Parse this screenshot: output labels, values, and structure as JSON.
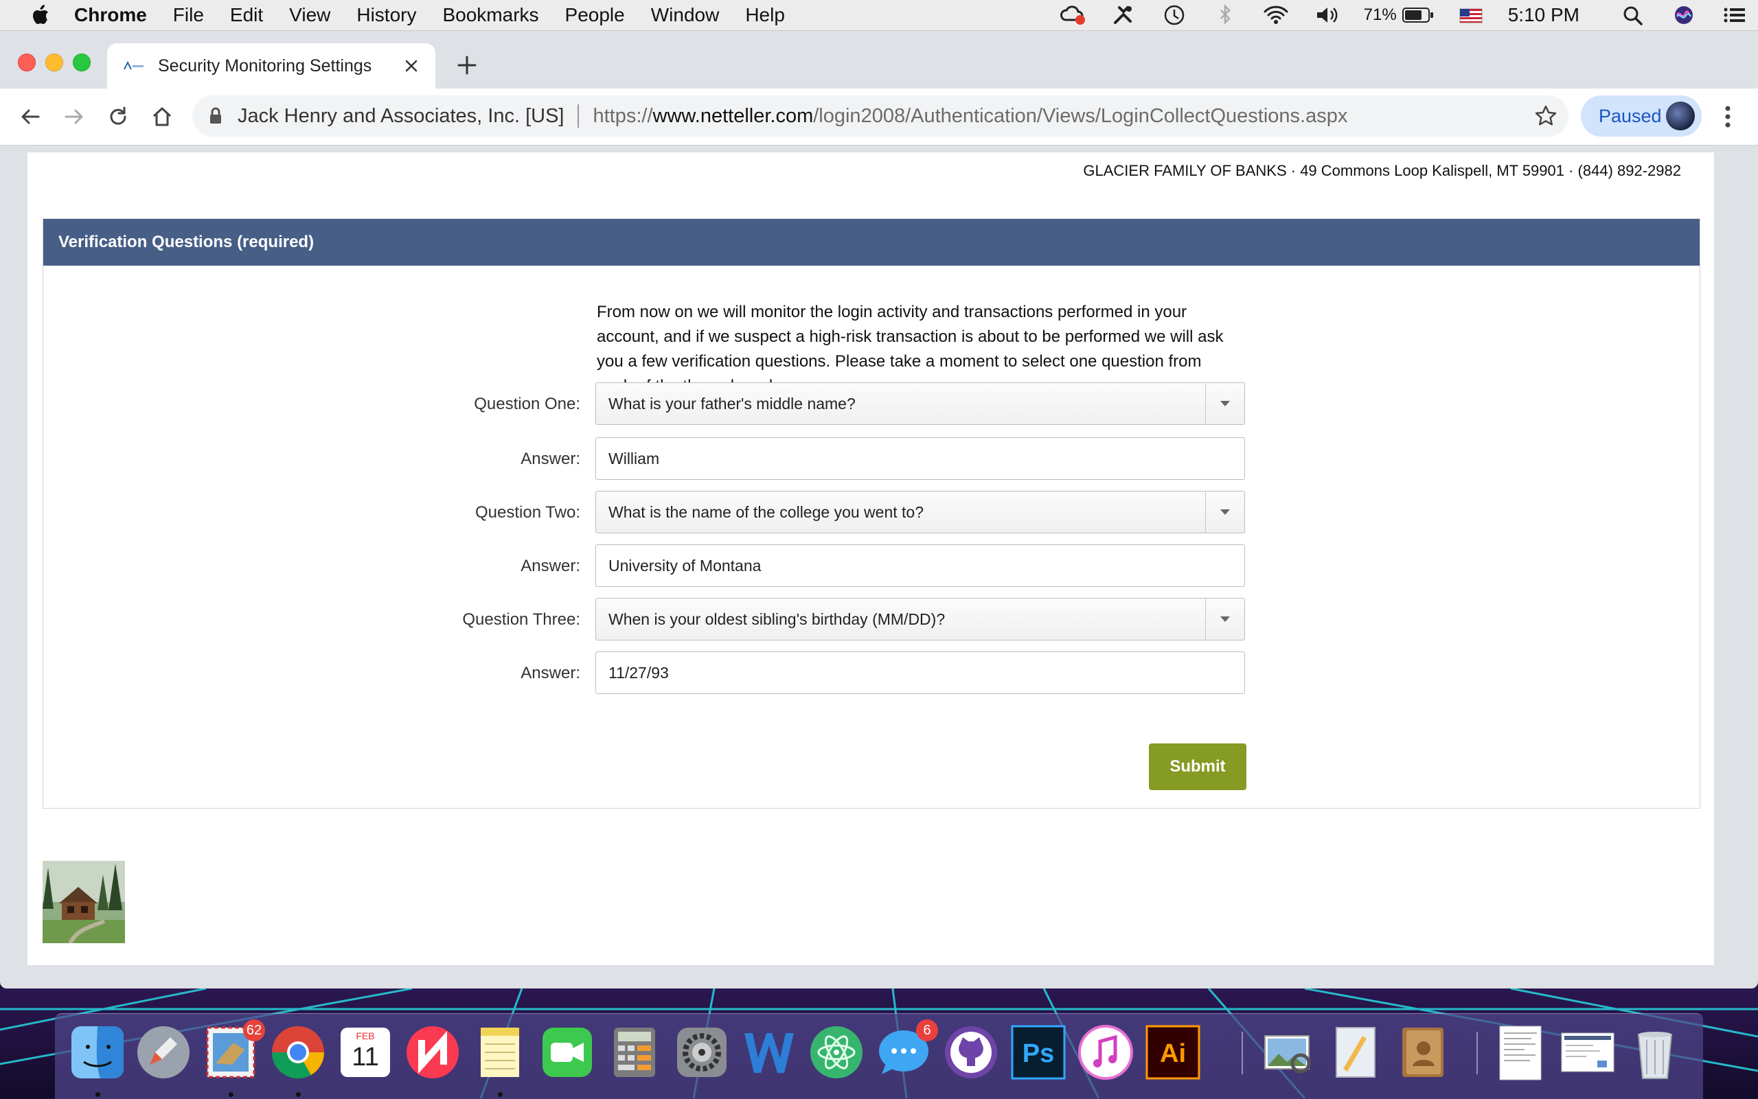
{
  "menubar": {
    "app_name": "Chrome",
    "items": [
      "File",
      "Edit",
      "View",
      "History",
      "Bookmarks",
      "People",
      "Window",
      "Help"
    ],
    "battery_percent": "71%",
    "clock": "5:10 PM"
  },
  "browser": {
    "tab_title": "Security Monitoring Settings",
    "organization": "Jack Henry and Associates, Inc. [US]",
    "url_scheme": "https://",
    "url_host": "www.netteller.com",
    "url_path": "/login2008/Authentication/Views/LoginCollectQuestions.aspx",
    "profile_status": "Paused"
  },
  "page": {
    "bank_header": "GLACIER FAMILY OF BANKS · 49 Commons Loop Kalispell, MT 59901 · (844) 892-2982",
    "panel_title": "Verification Questions (required)",
    "intro": "From now on we will monitor the login activity and transactions performed in your account, and if we suspect a high-risk transaction is about to be performed we will ask you a few verification questions. Please take a moment to select one question from each of the three drop-down menus.",
    "q1_label": "Question One:",
    "q1_value": "What is your father's middle name?",
    "a1_label": "Answer:",
    "a1_value": "William",
    "q2_label": "Question Two:",
    "q2_value": "What is the name of the college you went to?",
    "a2_label": "Answer:",
    "a2_value": "University of Montana",
    "q3_label": "Question Three:",
    "q3_value": "When is your oldest sibling's birthday (MM/DD)?",
    "a3_label": "Answer:",
    "a3_value": "11/27/93",
    "submit_label": "Submit"
  },
  "dock": {
    "mail_badge": "62",
    "calendar_month": "FEB",
    "calendar_day": "11",
    "messages_badge": "6"
  },
  "colors": {
    "panel_header": "#475e87",
    "submit_button": "#859b24",
    "paused_chip": "#d2e3fc"
  }
}
